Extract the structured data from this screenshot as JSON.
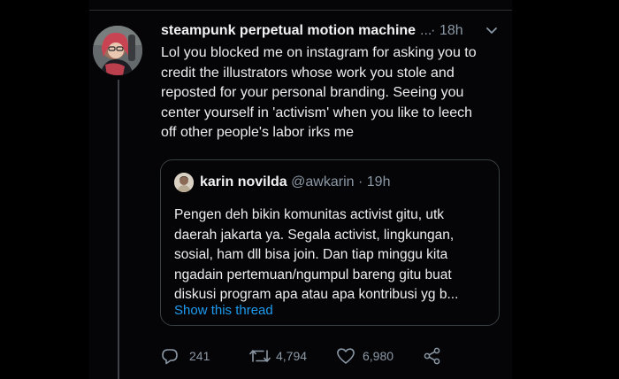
{
  "tweet": {
    "author": {
      "display_name": "steampunk perpetual motion machine",
      "name_truncation": "...",
      "avatar_icon": "avatar-illustrated-woman"
    },
    "separator": "·",
    "timestamp": "18h",
    "menu_icon": "chevron-down-icon",
    "text_lines": [
      "Lol you blocked me on instagram for asking you to",
      "credit the illustrators whose work you stole and",
      "reposted for your personal branding. Seeing you",
      "center yourself in 'activism' when you like to leech",
      "off other people's labor irks me"
    ],
    "quoted_tweet": {
      "display_name": "karin novilda",
      "handle": "@awkarin",
      "separator": "·",
      "timestamp": "19h",
      "text_lines": [
        "Pengen deh bikin komunitas activist gitu, utk",
        "daerah jakarta ya. Segala activist, lingkungan,",
        "sosial, ham dll bisa join. Dan tiap minggu kita",
        "ngadain pertemuan/ngumpul bareng gitu buat",
        "diskusi program apa atau apa kontribusi yg b..."
      ],
      "show_thread_label": "Show this thread"
    },
    "actions": {
      "reply_count": "241",
      "retweet_count": "4,794",
      "like_count": "6,980",
      "reply_icon": "reply-icon",
      "retweet_icon": "retweet-icon",
      "like_icon": "heart-icon",
      "share_icon": "share-icon"
    }
  },
  "colors": {
    "background": "#000000",
    "text_primary": "#eeeeee",
    "text_secondary": "#8b98a5",
    "link": "#1d9bf0",
    "border": "#3a3f44"
  }
}
